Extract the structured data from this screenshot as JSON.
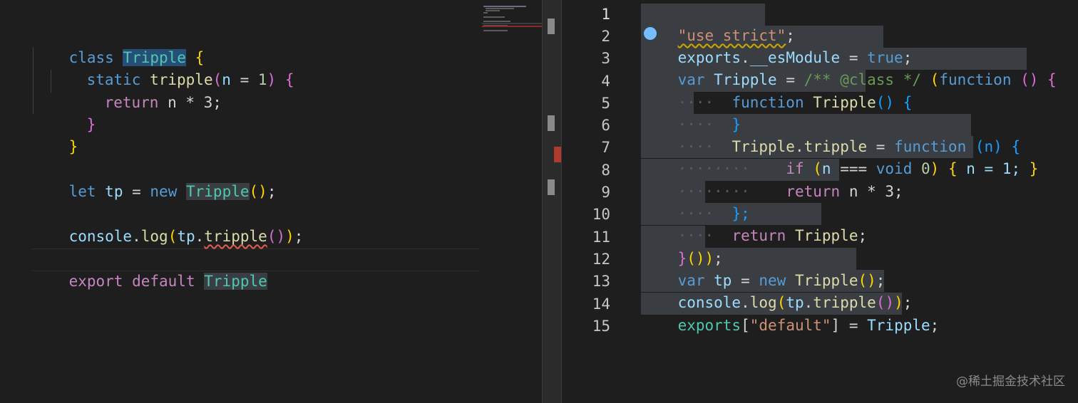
{
  "left_editor": {
    "line1": {
      "k": "class",
      "name": "Tripple",
      "brace": "{"
    },
    "line2": {
      "k": "static",
      "fn": "tripple",
      "p": "(",
      "param": "n",
      "eq": " = ",
      "val": "1",
      "pc": ")",
      "brace": "{"
    },
    "line3": {
      "k": "return",
      "expr": "n * 3;"
    },
    "line4": {
      "brace": "}"
    },
    "line5": {
      "brace": "}"
    },
    "line7": {
      "k": "let",
      "v": "tp",
      "eq": " = ",
      "new": "new",
      "cls": "Tripple",
      "call": "()",
      "semi": ";"
    },
    "line9": {
      "obj": "console",
      "dot1": ".",
      "fn": "log",
      "p1": "(",
      "v": "tp",
      "dot2": ".",
      "m": "tripple",
      "call": "()",
      "p2": ")",
      "semi": ";"
    },
    "line11": {
      "k1": "export",
      "k2": "default",
      "cls": "Tripple"
    }
  },
  "right_editor": {
    "line_numbers": [
      "1",
      "2",
      "3",
      "4",
      "5",
      "6",
      "7",
      "8",
      "9",
      "10",
      "11",
      "12",
      "13",
      "14",
      "15"
    ],
    "l1": {
      "str": "\"use strict\"",
      "semi": ";"
    },
    "l2": {
      "obj": "exports",
      "dot": ".",
      "prop": "__esModule",
      "eq": " = ",
      "val": "true",
      "semi": ";"
    },
    "l3": {
      "k": "var",
      "name": "Tripple",
      "eq": " = ",
      "cmt": "/** @class */",
      "p": "(",
      "fnk": "function",
      "args": " ()",
      "brace": " {"
    },
    "l4": {
      "ws": "····",
      "fnk": "function",
      "name": "Tripple",
      "args": "()",
      "brace": " {"
    },
    "l5": {
      "ws": "····",
      "brace": "}"
    },
    "l6": {
      "ws": "····",
      "name": "Tripple",
      "dot": ".",
      "m": "tripple",
      "eq": " = ",
      "fnk": "function",
      "args": " (n)",
      "brace": " {"
    },
    "l7": {
      "ws": "········",
      "k": "if",
      "cond1": " (",
      "n": "n",
      "op": " === ",
      "void": "void",
      "zero": " 0",
      "cond2": ")",
      "b1": " {",
      "body": " n = 1; ",
      "b2": "}"
    },
    "l8": {
      "ws": "········",
      "k": "return",
      "expr": " n * 3;"
    },
    "l9": {
      "ws": "····",
      "brace": "};"
    },
    "l10": {
      "ws": "····",
      "k": "return",
      "name": " Tripple",
      "semi": ";"
    },
    "l11": {
      "close": "}",
      "call": "())",
      "semi": ";"
    },
    "l12": {
      "k": "var",
      "v": " tp",
      "eq": " = ",
      "new": "new",
      "cls": " Tripple",
      "call": "()",
      "semi": ";"
    },
    "l13": {
      "obj": "console",
      "dot": ".",
      "fn": "log",
      "p1": "(",
      "v": "tp",
      "dot2": ".",
      "m": "tripple",
      "call": "()",
      "p2": ")",
      "semi": ";"
    },
    "l14": {
      "obj": "exports",
      "b1": "[",
      "str": "\"default\"",
      "b2": "]",
      "eq": " = ",
      "name": "Tripple",
      "semi": ";"
    }
  },
  "watermark": "@稀土掘金技术社区"
}
